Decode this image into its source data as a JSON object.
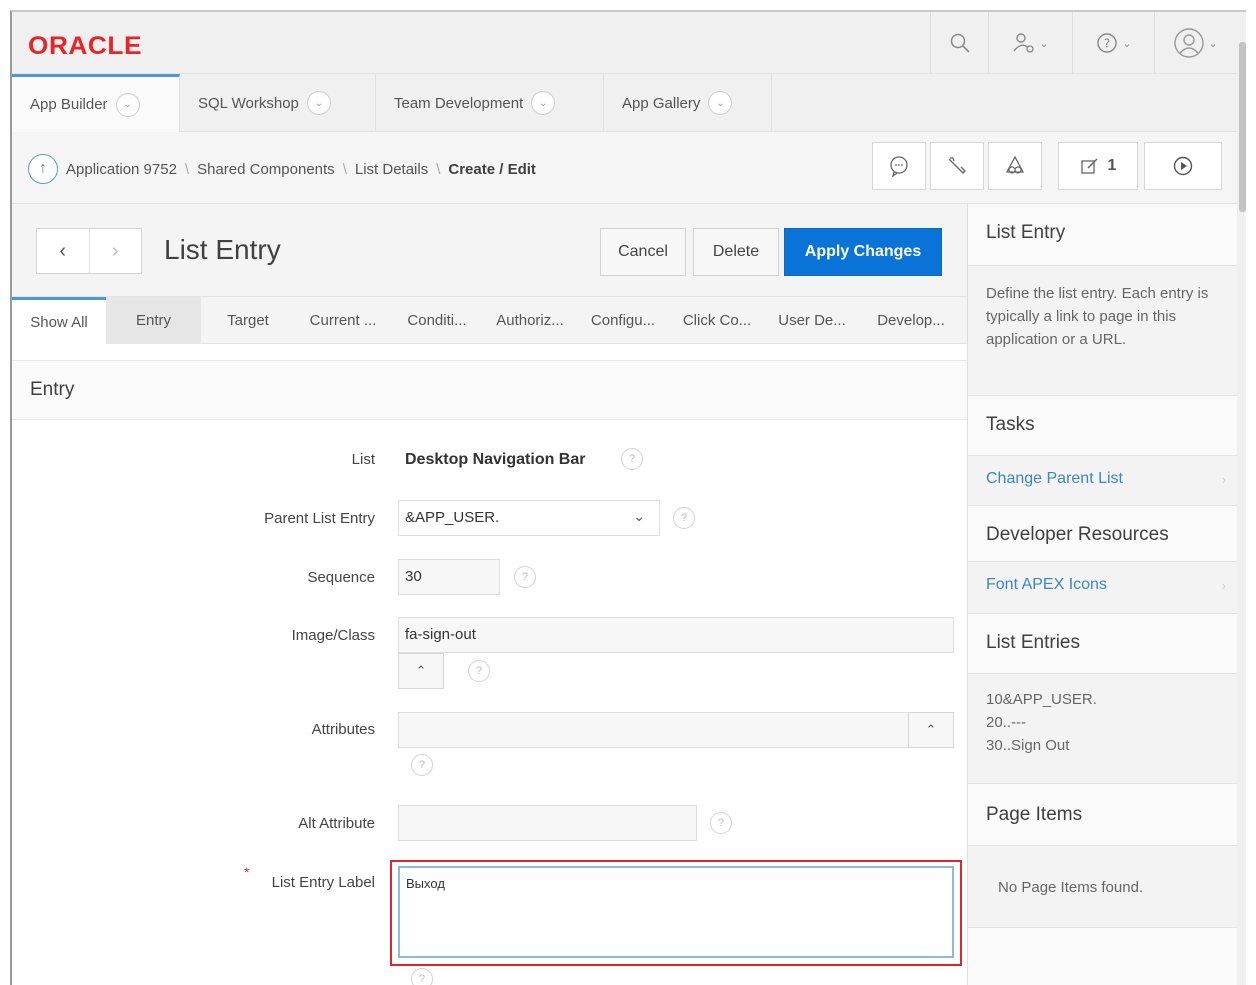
{
  "header": {
    "logo": "ORACLE",
    "buttons": [
      "search-icon",
      "admin-icon",
      "help-icon",
      "user-icon"
    ]
  },
  "tabs": [
    {
      "label": "App Builder",
      "active": true
    },
    {
      "label": "SQL Workshop",
      "active": false
    },
    {
      "label": "Team Development",
      "active": false
    },
    {
      "label": "App Gallery",
      "active": false
    }
  ],
  "breadcrumb": {
    "items": [
      "Application 9752",
      "Shared Components",
      "List Details",
      "Create / Edit"
    ],
    "separator": "\\",
    "toolbar": [
      "feedback-icon",
      "utilities-icon",
      "team-icon",
      "edit-count-icon",
      "run-icon"
    ],
    "edit_count": "1"
  },
  "titlebar": {
    "title": "List Entry",
    "cancel_label": "Cancel",
    "delete_label": "Delete",
    "apply_label": "Apply Changes"
  },
  "section_tabs": [
    "Show All",
    "Entry",
    "Target",
    "Current ...",
    "Conditi...",
    "Authoriz...",
    "Configu...",
    "Click Co...",
    "User De...",
    "Develop..."
  ],
  "form": {
    "region_title": "Entry",
    "list_label": "List",
    "list_value": "Desktop Navigation Bar",
    "parent_label": "Parent List Entry",
    "parent_value": "&APP_USER.",
    "sequence_label": "Sequence",
    "sequence_value": "30",
    "image_label": "Image/Class",
    "image_value": "fa-sign-out",
    "attributes_label": "Attributes",
    "attributes_value": "",
    "alt_label": "Alt Attribute",
    "alt_value": "",
    "entry_label": "List Entry Label",
    "entry_value": "Выход",
    "required_mark": "*"
  },
  "sidebar": {
    "list_entry_title": "List Entry",
    "list_entry_desc": "Define the list entry. Each entry is typically a link to page in this application or a URL.",
    "tasks_title": "Tasks",
    "tasks_link": "Change Parent List",
    "devres_title": "Developer Resources",
    "devres_link": "Font APEX Icons",
    "entries_title": "List Entries",
    "entries": [
      "10&APP_USER.",
      "20..---",
      "30..Sign Out"
    ],
    "page_items_title": "Page Items",
    "page_items_empty": "No Page Items found."
  },
  "colors": {
    "brand": "#e5252a",
    "primary_button": "#0a73d8",
    "link": "#3d86c6",
    "highlight_border": "#d9272e"
  }
}
